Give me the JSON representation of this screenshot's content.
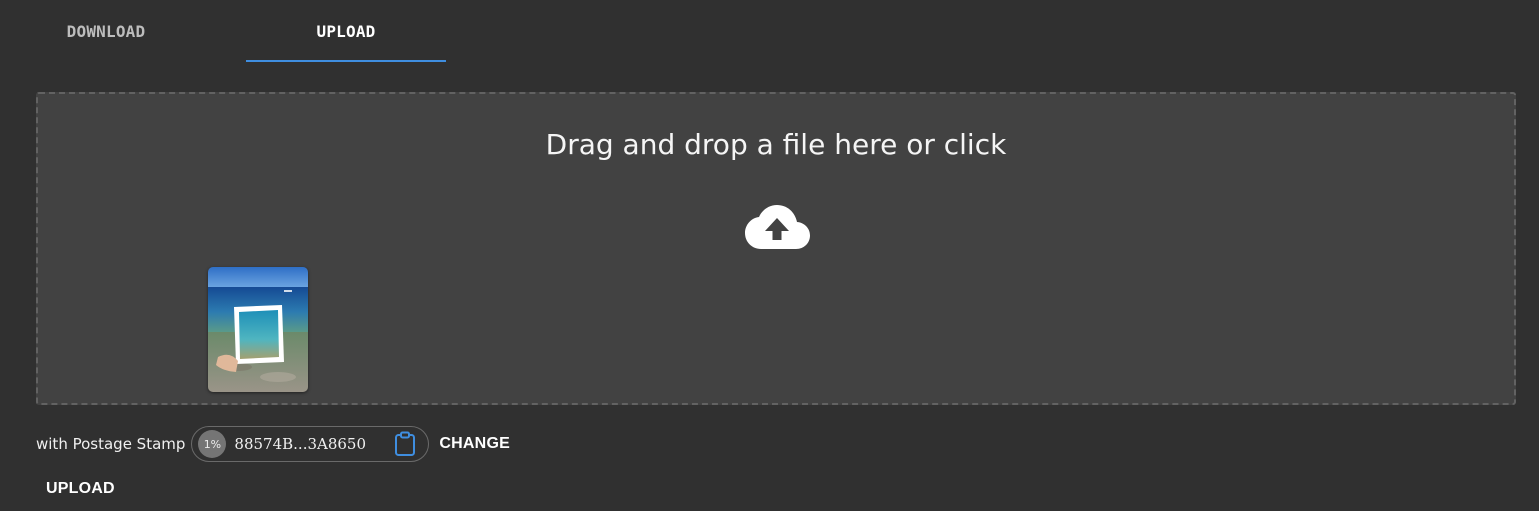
{
  "tabs": {
    "download_label": "DOWNLOAD",
    "upload_label": "UPLOAD",
    "active": "UPLOAD"
  },
  "dropzone": {
    "title": "Drag and drop a file here or click",
    "icon": "cloud-upload-icon",
    "thumbnail": "image-thumbnail"
  },
  "stamp": {
    "label": "with Postage Stamp",
    "usage": "1%",
    "id": "88574B...3A8650",
    "copy_icon": "clipboard-icon",
    "change_label": "CHANGE"
  },
  "actions": {
    "upload_label": "UPLOAD"
  },
  "colors": {
    "background": "#303030",
    "dropzone": "#424242",
    "accent": "#3f8ee0"
  }
}
